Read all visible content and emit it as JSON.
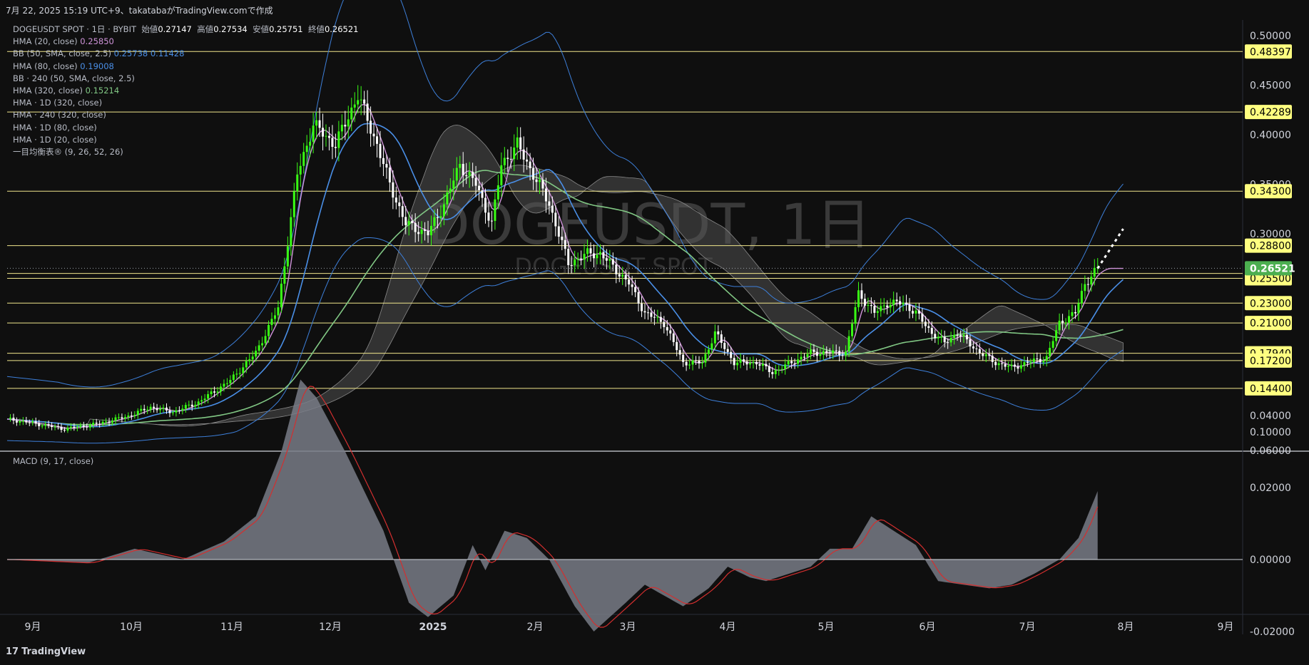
{
  "header": {
    "title": "7月 22, 2025 15:19 UTC+9、takatabaがTradingView.comで作成"
  },
  "symbol": {
    "name": "DOGEUSDT SPOT · 1日 · BYBIT",
    "open_label": "始値",
    "open": "0.27147",
    "high_label": "高値",
    "high": "0.27534",
    "low_label": "安値",
    "low": "0.25751",
    "close_label": "終値",
    "close": "0.26521"
  },
  "watermark": {
    "title": "DOGEUSDT, 1日",
    "subtitle": "DOGEUSDT SPOT"
  },
  "indicators": [
    {
      "label": "HMA (20, close)",
      "value": "0.25850",
      "color": "#ce93d8"
    },
    {
      "label": "BB (50, SMA, close, 2.5)",
      "value": "0.25738",
      "value2": "0.11428",
      "color": "#4a8fe7"
    },
    {
      "label": "HMA (80, close)",
      "value": "0.19008",
      "color": "#4a8fe7"
    },
    {
      "label": "BB · 240 (50, SMA, close, 2.5)",
      "value": "",
      "color": "#4a8fe7"
    },
    {
      "label": "HMA (320, close)",
      "value": "0.15214",
      "color": "#81c784"
    },
    {
      "label": "HMA · 1D (320, close)",
      "value": ""
    },
    {
      "label": "HMA · 240 (320, close)",
      "value": ""
    },
    {
      "label": "HMA · 1D (80, close)",
      "value": ""
    },
    {
      "label": "HMA · 1D (20, close)",
      "value": ""
    },
    {
      "label": "一目均衡表® (9, 26, 52, 26)",
      "value": ""
    }
  ],
  "macd": {
    "label": "MACD (9, 17, close)"
  },
  "brand": {
    "logo": "𝟭𝟳",
    "name": "TradingView"
  },
  "colors": {
    "up": "#4caf50",
    "upBright": "#39ff14",
    "down": "#ffffff",
    "hline": "#f0e68c",
    "hma20": "#ce93d8",
    "hma80": "#4a8fe7",
    "hma320": "#81c784",
    "bb": "#3d7fd9",
    "cloud": "#555555",
    "macd": "#d32f2f",
    "hist": "#787b86",
    "label_bg": "#ffff80",
    "last_bg": "#4caf50"
  },
  "chart_data": {
    "type": "candlestick",
    "price_axis": {
      "ticks": [
        "0.50000",
        "0.45000",
        "0.40000",
        "0.35000",
        "0.30000",
        "0.10000",
        "0.06000"
      ],
      "range": [
        0.06,
        0.52
      ]
    },
    "time_axis": {
      "ticks": [
        "9月",
        "10月",
        "11月",
        "12月",
        "2025",
        "2月",
        "3月",
        "4月",
        "5月",
        "6月",
        "7月",
        "8月",
        "9月"
      ]
    },
    "horizontal_levels": [
      "0.48397",
      "0.42289",
      "0.34300",
      "0.28800",
      "0.26000",
      "0.25500",
      "0.23000",
      "0.21000",
      "0.17940",
      "0.17200",
      "0.14400"
    ],
    "last_price": "0.26521",
    "macd_axis": {
      "ticks": [
        "0.04000",
        "0.02000",
        "0.00000",
        "-0.02000"
      ],
      "range": [
        -0.028,
        0.052
      ]
    },
    "price_path": [
      [
        0,
        0.113
      ],
      [
        8,
        0.109
      ],
      [
        18,
        0.103
      ],
      [
        28,
        0.108
      ],
      [
        38,
        0.116
      ],
      [
        45,
        0.125
      ],
      [
        52,
        0.12
      ],
      [
        60,
        0.13
      ],
      [
        70,
        0.152
      ],
      [
        78,
        0.18
      ],
      [
        85,
        0.225
      ],
      [
        91,
        0.36
      ],
      [
        96,
        0.41
      ],
      [
        103,
        0.39
      ],
      [
        110,
        0.44
      ],
      [
        116,
        0.39
      ],
      [
        120,
        0.35
      ],
      [
        125,
        0.31
      ],
      [
        132,
        0.3
      ],
      [
        137,
        0.33
      ],
      [
        142,
        0.37
      ],
      [
        147,
        0.35
      ],
      [
        152,
        0.31
      ],
      [
        155,
        0.37
      ],
      [
        160,
        0.39
      ],
      [
        165,
        0.36
      ],
      [
        170,
        0.33
      ],
      [
        176,
        0.27
      ],
      [
        182,
        0.28
      ],
      [
        186,
        0.28
      ],
      [
        195,
        0.25
      ],
      [
        200,
        0.22
      ],
      [
        206,
        0.21
      ],
      [
        212,
        0.17
      ],
      [
        218,
        0.17
      ],
      [
        222,
        0.2
      ],
      [
        228,
        0.17
      ],
      [
        235,
        0.17
      ],
      [
        240,
        0.16
      ],
      [
        246,
        0.17
      ],
      [
        252,
        0.18
      ],
      [
        258,
        0.18
      ],
      [
        263,
        0.18
      ],
      [
        267,
        0.24
      ],
      [
        272,
        0.22
      ],
      [
        276,
        0.23
      ],
      [
        281,
        0.23
      ],
      [
        285,
        0.22
      ],
      [
        290,
        0.2
      ],
      [
        294,
        0.19
      ],
      [
        298,
        0.2
      ],
      [
        305,
        0.18
      ],
      [
        310,
        0.17
      ],
      [
        315,
        0.165
      ],
      [
        320,
        0.17
      ],
      [
        326,
        0.175
      ],
      [
        330,
        0.21
      ],
      [
        335,
        0.22
      ],
      [
        338,
        0.25
      ],
      [
        342,
        0.265
      ]
    ],
    "projection": [
      [
        342,
        0.265
      ],
      [
        350,
        0.305
      ]
    ],
    "macd_path": [
      [
        0,
        0
      ],
      [
        25,
        -0.001
      ],
      [
        40,
        0.003
      ],
      [
        55,
        0
      ],
      [
        68,
        0.005
      ],
      [
        78,
        0.012
      ],
      [
        86,
        0.03
      ],
      [
        92,
        0.05
      ],
      [
        97,
        0.045
      ],
      [
        106,
        0.03
      ],
      [
        118,
        0.008
      ],
      [
        126,
        -0.012
      ],
      [
        132,
        -0.016
      ],
      [
        140,
        -0.01
      ],
      [
        146,
        0.004
      ],
      [
        150,
        -0.003
      ],
      [
        156,
        0.008
      ],
      [
        163,
        0.006
      ],
      [
        170,
        0
      ],
      [
        178,
        -0.013
      ],
      [
        184,
        -0.02
      ],
      [
        194,
        -0.012
      ],
      [
        200,
        -0.007
      ],
      [
        206,
        -0.01
      ],
      [
        212,
        -0.013
      ],
      [
        220,
        -0.008
      ],
      [
        226,
        -0.002
      ],
      [
        233,
        -0.005
      ],
      [
        238,
        -0.006
      ],
      [
        245,
        -0.004
      ],
      [
        252,
        -0.002
      ],
      [
        258,
        0.003
      ],
      [
        265,
        0.003
      ],
      [
        271,
        0.012
      ],
      [
        278,
        0.008
      ],
      [
        285,
        0.004
      ],
      [
        292,
        -0.006
      ],
      [
        300,
        -0.007
      ],
      [
        308,
        -0.008
      ],
      [
        315,
        -0.007
      ],
      [
        322,
        -0.004
      ],
      [
        330,
        0
      ],
      [
        336,
        0.006
      ],
      [
        342,
        0.019
      ]
    ]
  }
}
